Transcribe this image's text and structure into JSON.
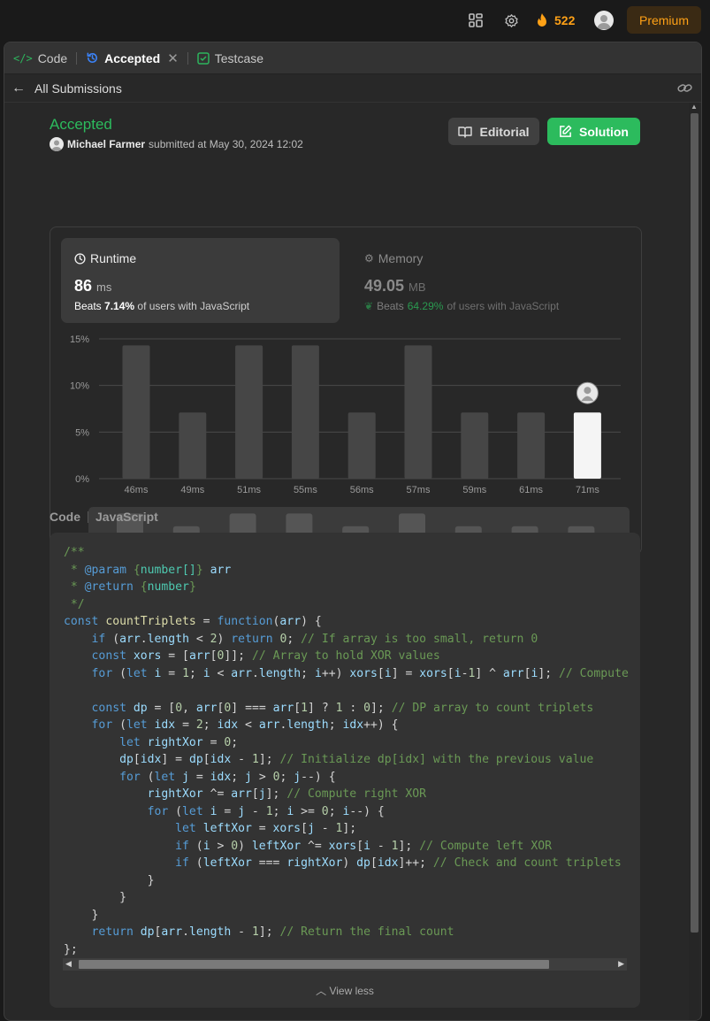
{
  "topbar": {
    "streak_count": "522",
    "premium_label": "Premium"
  },
  "tabs": [
    {
      "label": "Code"
    },
    {
      "label": "Accepted"
    },
    {
      "label": "Testcase"
    }
  ],
  "subbar": {
    "back_label": "All Submissions"
  },
  "submission": {
    "status": "Accepted",
    "user": "Michael Farmer",
    "submitted_text": "submitted at May 30, 2024 12:02"
  },
  "actions": {
    "editorial_label": "Editorial",
    "solution_label": "Solution"
  },
  "runtime": {
    "title": "Runtime",
    "value": "86",
    "unit": "ms",
    "beats_prefix": "Beats",
    "beats_pct": "7.14%",
    "beats_suffix": "of users with JavaScript"
  },
  "memory": {
    "title": "Memory",
    "value": "49.05",
    "unit": "MB",
    "beats_prefix": "Beats",
    "beats_pct": "64.29%",
    "beats_suffix": "of users with JavaScript"
  },
  "chart_data": {
    "type": "bar",
    "categories": [
      "46ms",
      "49ms",
      "51ms",
      "55ms",
      "56ms",
      "57ms",
      "59ms",
      "61ms",
      "71ms"
    ],
    "values": [
      14.3,
      7.1,
      14.3,
      14.3,
      7.1,
      14.3,
      7.1,
      7.1,
      7.1
    ],
    "highlight_index": 8,
    "y_ticks": [
      "0%",
      "5%",
      "10%",
      "15%"
    ],
    "ylim": [
      0,
      15
    ],
    "grid": true,
    "bar_color": "#464646",
    "highlight_color": "#f5f5f5"
  },
  "code_header": {
    "left": "Code",
    "right": "JavaScript"
  },
  "code": {
    "lines": [
      [
        {
          "t": "/**",
          "c": "cm"
        }
      ],
      [
        {
          "t": " * ",
          "c": "cm"
        },
        {
          "t": "@param",
          "c": "kw"
        },
        {
          "t": " {",
          "c": "cm"
        },
        {
          "t": "number[]",
          "c": "ty"
        },
        {
          "t": "} ",
          "c": "cm"
        },
        {
          "t": "arr",
          "c": "vr"
        }
      ],
      [
        {
          "t": " * ",
          "c": "cm"
        },
        {
          "t": "@return",
          "c": "kw"
        },
        {
          "t": " {",
          "c": "cm"
        },
        {
          "t": "number",
          "c": "ty"
        },
        {
          "t": "}",
          "c": "cm"
        }
      ],
      [
        {
          "t": " */",
          "c": "cm"
        }
      ],
      [
        {
          "t": "const ",
          "c": "kw"
        },
        {
          "t": "countTriplets",
          "c": "fn"
        },
        {
          "t": " = ",
          "c": "op"
        },
        {
          "t": "function",
          "c": "kw"
        },
        {
          "t": "(",
          "c": "op"
        },
        {
          "t": "arr",
          "c": "vr"
        },
        {
          "t": ") {",
          "c": "op"
        }
      ],
      [
        {
          "t": "    ",
          "c": "op"
        },
        {
          "t": "if",
          "c": "kw"
        },
        {
          "t": " (",
          "c": "op"
        },
        {
          "t": "arr",
          "c": "vr"
        },
        {
          "t": ".",
          "c": "op"
        },
        {
          "t": "length",
          "c": "vr"
        },
        {
          "t": " < ",
          "c": "op"
        },
        {
          "t": "2",
          "c": "nm"
        },
        {
          "t": ") ",
          "c": "op"
        },
        {
          "t": "return",
          "c": "kw"
        },
        {
          "t": " ",
          "c": "op"
        },
        {
          "t": "0",
          "c": "nm"
        },
        {
          "t": "; ",
          "c": "op"
        },
        {
          "t": "// If array is too small, return 0",
          "c": "cm"
        }
      ],
      [
        {
          "t": "    ",
          "c": "op"
        },
        {
          "t": "const",
          "c": "kw"
        },
        {
          "t": " ",
          "c": "op"
        },
        {
          "t": "xors",
          "c": "vr"
        },
        {
          "t": " = [",
          "c": "op"
        },
        {
          "t": "arr",
          "c": "vr"
        },
        {
          "t": "[",
          "c": "op"
        },
        {
          "t": "0",
          "c": "nm"
        },
        {
          "t": "]]; ",
          "c": "op"
        },
        {
          "t": "// Array to hold XOR values",
          "c": "cm"
        }
      ],
      [
        {
          "t": "    ",
          "c": "op"
        },
        {
          "t": "for",
          "c": "kw"
        },
        {
          "t": " (",
          "c": "op"
        },
        {
          "t": "let",
          "c": "kw"
        },
        {
          "t": " ",
          "c": "op"
        },
        {
          "t": "i",
          "c": "vr"
        },
        {
          "t": " = ",
          "c": "op"
        },
        {
          "t": "1",
          "c": "nm"
        },
        {
          "t": "; ",
          "c": "op"
        },
        {
          "t": "i",
          "c": "vr"
        },
        {
          "t": " < ",
          "c": "op"
        },
        {
          "t": "arr",
          "c": "vr"
        },
        {
          "t": ".",
          "c": "op"
        },
        {
          "t": "length",
          "c": "vr"
        },
        {
          "t": "; ",
          "c": "op"
        },
        {
          "t": "i",
          "c": "vr"
        },
        {
          "t": "++) ",
          "c": "op"
        },
        {
          "t": "xors",
          "c": "vr"
        },
        {
          "t": "[",
          "c": "op"
        },
        {
          "t": "i",
          "c": "vr"
        },
        {
          "t": "] = ",
          "c": "op"
        },
        {
          "t": "xors",
          "c": "vr"
        },
        {
          "t": "[",
          "c": "op"
        },
        {
          "t": "i",
          "c": "vr"
        },
        {
          "t": "-",
          "c": "op"
        },
        {
          "t": "1",
          "c": "nm"
        },
        {
          "t": "] ^ ",
          "c": "op"
        },
        {
          "t": "arr",
          "c": "vr"
        },
        {
          "t": "[",
          "c": "op"
        },
        {
          "t": "i",
          "c": "vr"
        },
        {
          "t": "]; ",
          "c": "op"
        },
        {
          "t": "// Compute",
          "c": "cm"
        }
      ],
      [],
      [
        {
          "t": "    ",
          "c": "op"
        },
        {
          "t": "const",
          "c": "kw"
        },
        {
          "t": " ",
          "c": "op"
        },
        {
          "t": "dp",
          "c": "vr"
        },
        {
          "t": " = [",
          "c": "op"
        },
        {
          "t": "0",
          "c": "nm"
        },
        {
          "t": ", ",
          "c": "op"
        },
        {
          "t": "arr",
          "c": "vr"
        },
        {
          "t": "[",
          "c": "op"
        },
        {
          "t": "0",
          "c": "nm"
        },
        {
          "t": "] === ",
          "c": "op"
        },
        {
          "t": "arr",
          "c": "vr"
        },
        {
          "t": "[",
          "c": "op"
        },
        {
          "t": "1",
          "c": "nm"
        },
        {
          "t": "] ? ",
          "c": "op"
        },
        {
          "t": "1",
          "c": "nm"
        },
        {
          "t": " : ",
          "c": "op"
        },
        {
          "t": "0",
          "c": "nm"
        },
        {
          "t": "]; ",
          "c": "op"
        },
        {
          "t": "// DP array to count triplets",
          "c": "cm"
        }
      ],
      [
        {
          "t": "    ",
          "c": "op"
        },
        {
          "t": "for",
          "c": "kw"
        },
        {
          "t": " (",
          "c": "op"
        },
        {
          "t": "let",
          "c": "kw"
        },
        {
          "t": " ",
          "c": "op"
        },
        {
          "t": "idx",
          "c": "vr"
        },
        {
          "t": " = ",
          "c": "op"
        },
        {
          "t": "2",
          "c": "nm"
        },
        {
          "t": "; ",
          "c": "op"
        },
        {
          "t": "idx",
          "c": "vr"
        },
        {
          "t": " < ",
          "c": "op"
        },
        {
          "t": "arr",
          "c": "vr"
        },
        {
          "t": ".",
          "c": "op"
        },
        {
          "t": "length",
          "c": "vr"
        },
        {
          "t": "; ",
          "c": "op"
        },
        {
          "t": "idx",
          "c": "vr"
        },
        {
          "t": "++) {",
          "c": "op"
        }
      ],
      [
        {
          "t": "        ",
          "c": "op"
        },
        {
          "t": "let",
          "c": "kw"
        },
        {
          "t": " ",
          "c": "op"
        },
        {
          "t": "rightXor",
          "c": "vr"
        },
        {
          "t": " = ",
          "c": "op"
        },
        {
          "t": "0",
          "c": "nm"
        },
        {
          "t": ";",
          "c": "op"
        }
      ],
      [
        {
          "t": "        ",
          "c": "op"
        },
        {
          "t": "dp",
          "c": "vr"
        },
        {
          "t": "[",
          "c": "op"
        },
        {
          "t": "idx",
          "c": "vr"
        },
        {
          "t": "] = ",
          "c": "op"
        },
        {
          "t": "dp",
          "c": "vr"
        },
        {
          "t": "[",
          "c": "op"
        },
        {
          "t": "idx",
          "c": "vr"
        },
        {
          "t": " - ",
          "c": "op"
        },
        {
          "t": "1",
          "c": "nm"
        },
        {
          "t": "]; ",
          "c": "op"
        },
        {
          "t": "// Initialize dp[idx] with the previous value",
          "c": "cm"
        }
      ],
      [
        {
          "t": "        ",
          "c": "op"
        },
        {
          "t": "for",
          "c": "kw"
        },
        {
          "t": " (",
          "c": "op"
        },
        {
          "t": "let",
          "c": "kw"
        },
        {
          "t": " ",
          "c": "op"
        },
        {
          "t": "j",
          "c": "vr"
        },
        {
          "t": " = ",
          "c": "op"
        },
        {
          "t": "idx",
          "c": "vr"
        },
        {
          "t": "; ",
          "c": "op"
        },
        {
          "t": "j",
          "c": "vr"
        },
        {
          "t": " > ",
          "c": "op"
        },
        {
          "t": "0",
          "c": "nm"
        },
        {
          "t": "; ",
          "c": "op"
        },
        {
          "t": "j",
          "c": "vr"
        },
        {
          "t": "--) {",
          "c": "op"
        }
      ],
      [
        {
          "t": "            ",
          "c": "op"
        },
        {
          "t": "rightXor",
          "c": "vr"
        },
        {
          "t": " ^= ",
          "c": "op"
        },
        {
          "t": "arr",
          "c": "vr"
        },
        {
          "t": "[",
          "c": "op"
        },
        {
          "t": "j",
          "c": "vr"
        },
        {
          "t": "]; ",
          "c": "op"
        },
        {
          "t": "// Compute right XOR",
          "c": "cm"
        }
      ],
      [
        {
          "t": "            ",
          "c": "op"
        },
        {
          "t": "for",
          "c": "kw"
        },
        {
          "t": " (",
          "c": "op"
        },
        {
          "t": "let",
          "c": "kw"
        },
        {
          "t": " ",
          "c": "op"
        },
        {
          "t": "i",
          "c": "vr"
        },
        {
          "t": " = ",
          "c": "op"
        },
        {
          "t": "j",
          "c": "vr"
        },
        {
          "t": " - ",
          "c": "op"
        },
        {
          "t": "1",
          "c": "nm"
        },
        {
          "t": "; ",
          "c": "op"
        },
        {
          "t": "i",
          "c": "vr"
        },
        {
          "t": " >= ",
          "c": "op"
        },
        {
          "t": "0",
          "c": "nm"
        },
        {
          "t": "; ",
          "c": "op"
        },
        {
          "t": "i",
          "c": "vr"
        },
        {
          "t": "--) {",
          "c": "op"
        }
      ],
      [
        {
          "t": "                ",
          "c": "op"
        },
        {
          "t": "let",
          "c": "kw"
        },
        {
          "t": " ",
          "c": "op"
        },
        {
          "t": "leftXor",
          "c": "vr"
        },
        {
          "t": " = ",
          "c": "op"
        },
        {
          "t": "xors",
          "c": "vr"
        },
        {
          "t": "[",
          "c": "op"
        },
        {
          "t": "j",
          "c": "vr"
        },
        {
          "t": " - ",
          "c": "op"
        },
        {
          "t": "1",
          "c": "nm"
        },
        {
          "t": "];",
          "c": "op"
        }
      ],
      [
        {
          "t": "                ",
          "c": "op"
        },
        {
          "t": "if",
          "c": "kw"
        },
        {
          "t": " (",
          "c": "op"
        },
        {
          "t": "i",
          "c": "vr"
        },
        {
          "t": " > ",
          "c": "op"
        },
        {
          "t": "0",
          "c": "nm"
        },
        {
          "t": ") ",
          "c": "op"
        },
        {
          "t": "leftXor",
          "c": "vr"
        },
        {
          "t": " ^= ",
          "c": "op"
        },
        {
          "t": "xors",
          "c": "vr"
        },
        {
          "t": "[",
          "c": "op"
        },
        {
          "t": "i",
          "c": "vr"
        },
        {
          "t": " - ",
          "c": "op"
        },
        {
          "t": "1",
          "c": "nm"
        },
        {
          "t": "]; ",
          "c": "op"
        },
        {
          "t": "// Compute left XOR",
          "c": "cm"
        }
      ],
      [
        {
          "t": "                ",
          "c": "op"
        },
        {
          "t": "if",
          "c": "kw"
        },
        {
          "t": " (",
          "c": "op"
        },
        {
          "t": "leftXor",
          "c": "vr"
        },
        {
          "t": " === ",
          "c": "op"
        },
        {
          "t": "rightXor",
          "c": "vr"
        },
        {
          "t": ") ",
          "c": "op"
        },
        {
          "t": "dp",
          "c": "vr"
        },
        {
          "t": "[",
          "c": "op"
        },
        {
          "t": "idx",
          "c": "vr"
        },
        {
          "t": "]++; ",
          "c": "op"
        },
        {
          "t": "// Check and count triplets",
          "c": "cm"
        }
      ],
      [
        {
          "t": "            }",
          "c": "op"
        }
      ],
      [
        {
          "t": "        }",
          "c": "op"
        }
      ],
      [
        {
          "t": "    }",
          "c": "op"
        }
      ],
      [
        {
          "t": "    ",
          "c": "op"
        },
        {
          "t": "return",
          "c": "kw"
        },
        {
          "t": " ",
          "c": "op"
        },
        {
          "t": "dp",
          "c": "vr"
        },
        {
          "t": "[",
          "c": "op"
        },
        {
          "t": "arr",
          "c": "vr"
        },
        {
          "t": ".",
          "c": "op"
        },
        {
          "t": "length",
          "c": "vr"
        },
        {
          "t": " - ",
          "c": "op"
        },
        {
          "t": "1",
          "c": "nm"
        },
        {
          "t": "]; ",
          "c": "op"
        },
        {
          "t": "// Return the final count",
          "c": "cm"
        }
      ],
      [
        {
          "t": "};",
          "c": "op"
        }
      ]
    ]
  },
  "view_less_label": "View less"
}
